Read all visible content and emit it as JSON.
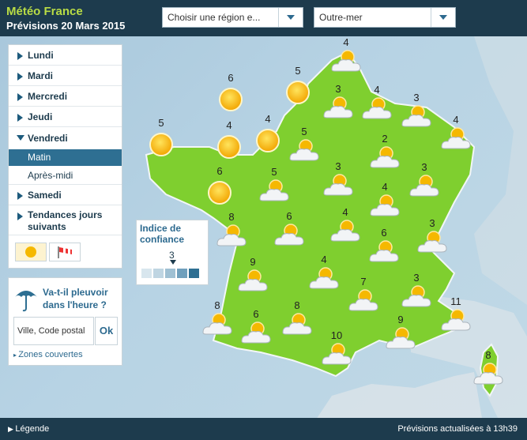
{
  "header": {
    "brand": "Météo France",
    "subtitle": "Prévisions 20 Mars 2015",
    "region_select": "Choisir une région e...",
    "outremer_select": "Outre-mer"
  },
  "sidebar": {
    "days": [
      {
        "label": "Lundi"
      },
      {
        "label": "Mardi"
      },
      {
        "label": "Mercredi"
      },
      {
        "label": "Jeudi"
      },
      {
        "label": "Vendredi",
        "expanded": true
      },
      {
        "label": "Samedi"
      },
      {
        "label": "Tendances jours suivants"
      }
    ],
    "sub_items": {
      "matin": "Matin",
      "apres_midi": "Après-midi"
    },
    "toggles": [
      "sun-icon",
      "windsock-icon"
    ]
  },
  "rain": {
    "title": "Va-t-il pleuvoir dans l'heure ?",
    "input_placeholder": "Ville, Code postal",
    "ok": "Ok",
    "zones": "Zones couvertes"
  },
  "confidence": {
    "title": "Indice de confiance",
    "value": "3",
    "scale_colors": [
      "#d8e6ee",
      "#bfd5e2",
      "#9fc0d3",
      "#6f9fbc",
      "#2e6f92"
    ]
  },
  "footer": {
    "legend": "Légende",
    "updated": "Prévisions actualisées à 13h39"
  },
  "colors": {
    "header_bg": "#1d3b4d",
    "land": "#7fcf2f",
    "sea": "#b2cfe1",
    "accent": "#2e6f92"
  },
  "forecast": {
    "markers": [
      {
        "icon": "sun-icon",
        "value": "6"
      },
      {
        "icon": "sun-icon",
        "value": "5"
      },
      {
        "icon": "sun-icon",
        "value": "5"
      },
      {
        "icon": "sun-icon",
        "value": "4"
      },
      {
        "icon": "sun-icon",
        "value": "4"
      },
      {
        "icon": "sun-icon",
        "value": "6"
      },
      {
        "icon": "partly-cloudy-icon",
        "value": "4"
      },
      {
        "icon": "partly-cloudy-icon",
        "value": "3"
      },
      {
        "icon": "partly-cloudy-icon",
        "value": "4"
      },
      {
        "icon": "partly-cloudy-icon",
        "value": "3"
      },
      {
        "icon": "partly-cloudy-icon",
        "value": "4"
      },
      {
        "icon": "partly-cloudy-icon",
        "value": "5"
      },
      {
        "icon": "partly-cloudy-icon",
        "value": "2"
      },
      {
        "icon": "partly-cloudy-icon",
        "value": "3"
      },
      {
        "icon": "partly-cloudy-icon",
        "value": "5"
      },
      {
        "icon": "partly-cloudy-icon",
        "value": "3"
      },
      {
        "icon": "partly-cloudy-icon",
        "value": "4"
      },
      {
        "icon": "partly-cloudy-icon",
        "value": "8"
      },
      {
        "icon": "partly-cloudy-icon",
        "value": "6"
      },
      {
        "icon": "partly-cloudy-icon",
        "value": "4"
      },
      {
        "icon": "partly-cloudy-icon",
        "value": "6"
      },
      {
        "icon": "partly-cloudy-icon",
        "value": "3"
      },
      {
        "icon": "partly-cloudy-icon",
        "value": "9"
      },
      {
        "icon": "partly-cloudy-icon",
        "value": "4"
      },
      {
        "icon": "partly-cloudy-icon",
        "value": "7"
      },
      {
        "icon": "partly-cloudy-icon",
        "value": "3"
      },
      {
        "icon": "partly-cloudy-icon",
        "value": "8"
      },
      {
        "icon": "partly-cloudy-icon",
        "value": "6"
      },
      {
        "icon": "partly-cloudy-icon",
        "value": "8"
      },
      {
        "icon": "partly-cloudy-icon",
        "value": "10"
      },
      {
        "icon": "partly-cloudy-icon",
        "value": "9"
      },
      {
        "icon": "partly-cloudy-icon",
        "value": "11"
      },
      {
        "icon": "partly-cloudy-icon",
        "value": "8"
      }
    ]
  }
}
